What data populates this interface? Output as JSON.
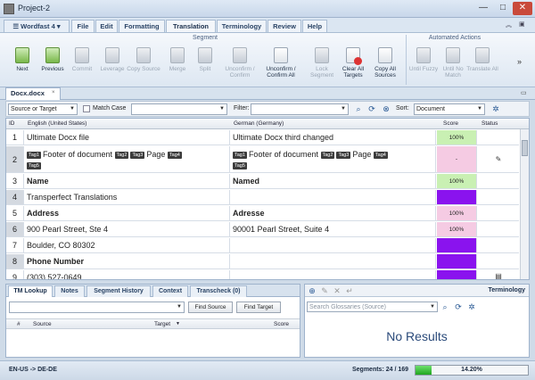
{
  "window": {
    "title": "Project-2",
    "min": "—",
    "max": "□",
    "close": "✕"
  },
  "menu": {
    "app_button": "Wordfast 4",
    "tabs": [
      "File",
      "Edit",
      "Formatting",
      "Translation",
      "Terminology",
      "Review",
      "Help"
    ],
    "active_tab": "Translation"
  },
  "ribbon": {
    "group1_label": "Segment",
    "group2_label": "Automated Actions",
    "buttons": [
      {
        "label": "Next",
        "enabled": true,
        "icon": "next-icon"
      },
      {
        "label": "Previous",
        "enabled": true,
        "icon": "previous-icon"
      },
      {
        "label": "Commit",
        "enabled": false,
        "icon": "commit-icon"
      },
      {
        "label": "Leverage",
        "enabled": false,
        "icon": "leverage-icon"
      },
      {
        "label": "Copy Source",
        "enabled": false,
        "icon": "copy-source-icon"
      },
      {
        "label": "Merge",
        "enabled": false,
        "icon": "merge-icon"
      },
      {
        "label": "Split",
        "enabled": false,
        "icon": "split-icon"
      },
      {
        "label": "Unconfirm / Confirm",
        "enabled": false,
        "icon": "unconfirm-icon"
      },
      {
        "label": "Unconfirm / Confirm All",
        "enabled": true,
        "icon": "unconfirm-all-icon"
      },
      {
        "label": "Lock Segment",
        "enabled": false,
        "icon": "lock-icon"
      },
      {
        "label": "Clear All Targets",
        "enabled": true,
        "icon": "clear-targets-icon"
      },
      {
        "label": "Copy All Sources",
        "enabled": true,
        "icon": "copy-all-sources-icon"
      },
      {
        "label": "Until Fuzzy",
        "enabled": false,
        "icon": "until-fuzzy-icon"
      },
      {
        "label": "Until No Match",
        "enabled": false,
        "icon": "until-no-match-icon"
      },
      {
        "label": "Translate All",
        "enabled": false,
        "icon": "translate-all-icon"
      }
    ],
    "more": "»"
  },
  "doc_tab": {
    "name": "Docx.docx",
    "close": "×"
  },
  "filter": {
    "scope": "Source or Target",
    "match_case_label": "Match Case",
    "filter_label": "Filter:",
    "sort_label": "Sort:",
    "sort_value": "Document"
  },
  "grid": {
    "headers": {
      "id": "ID",
      "source": "English (United States)",
      "target": "German (Germany)",
      "score": "Score",
      "status": "Status"
    },
    "rows": [
      {
        "id": "1",
        "source": "Ultimate Docx file",
        "target": "Ultimate Docx third changed",
        "score": "100%"
      },
      {
        "id": "2",
        "source_text": "Footer of document",
        "source_page": "Page",
        "target_text": "Footer of document",
        "target_page": "Page",
        "tags": [
          "Tag1",
          "Tag2",
          "Tag3",
          "Tag4",
          "Tag5"
        ],
        "score": "-"
      },
      {
        "id": "3",
        "source": "Name",
        "target": "Named",
        "score": "100%"
      },
      {
        "id": "4",
        "source": "Transperfect Translations",
        "target": "",
        "score": ""
      },
      {
        "id": "5",
        "source": "Address",
        "target": "Adresse",
        "score": "100%"
      },
      {
        "id": "6",
        "source": "900 Pearl Street, Ste 4",
        "target": "90001 Pearl Street, Suite 4",
        "score": "100%"
      },
      {
        "id": "7",
        "source": "Boulder, CO 80302",
        "target": "",
        "score": ""
      },
      {
        "id": "8",
        "source": "Phone Number",
        "target": "",
        "score": ""
      },
      {
        "id": "9",
        "source": "(303) 527-0649",
        "target": "",
        "score": ""
      }
    ]
  },
  "lookup_panel": {
    "tabs": [
      "TM Lookup",
      "Notes",
      "Segment History",
      "Context",
      "Transcheck (0)"
    ],
    "find_source": "Find Source",
    "find_target": "Find Target",
    "columns": [
      "#",
      "Source",
      "Target",
      "Score"
    ]
  },
  "terminology_panel": {
    "title": "Terminology",
    "search_placeholder": "Search Glossaries (Source)",
    "results": "No Results"
  },
  "status": {
    "language_pair": "EN-US -> DE-DE",
    "segments": "Segments: 24 / 169",
    "progress_text": "14.20%",
    "progress": 0.142
  },
  "colors": {
    "score_green": "#c9f0b3",
    "score_pink": "#f5cbe3",
    "score_purple": "#8a13ee",
    "progress": "#1fa51f"
  }
}
